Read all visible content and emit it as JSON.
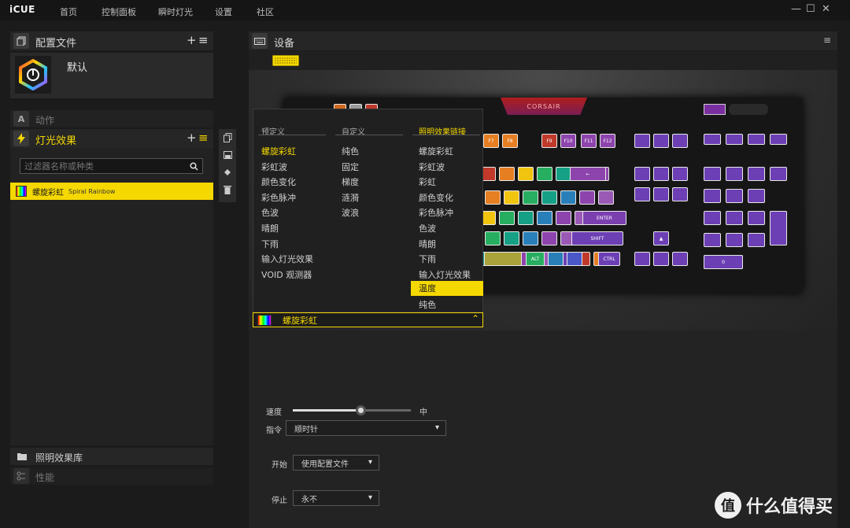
{
  "app": {
    "title": "iCUE"
  },
  "nav": [
    {
      "label": "首页"
    },
    {
      "label": "控制面板"
    },
    {
      "label": "瞬时灯光"
    },
    {
      "label": "设置"
    },
    {
      "label": "社区"
    }
  ],
  "window_controls": {
    "minimize": "—",
    "maximize": "☐",
    "close": "✕"
  },
  "profiles": {
    "title": "配置文件",
    "add": "+",
    "menu": "≡",
    "items": [
      {
        "label": "默认"
      }
    ]
  },
  "actions": {
    "title": "动作",
    "icon_letter": "A"
  },
  "lighting": {
    "title": "灯光效果",
    "add": "+",
    "menu": "≡",
    "filter_placeholder": "过滤器名称或种类",
    "effects": [
      {
        "name_cn": "螺旋彩虹",
        "name_en": "Spiral Rainbow"
      }
    ]
  },
  "library": {
    "title": "照明效果库"
  },
  "performance": {
    "title": "性能"
  },
  "device": {
    "title": "设备",
    "menu_icon": "≡"
  },
  "brand": {
    "logo_text": "CORSAIR",
    "accent": "#f5d800"
  },
  "dropdown": {
    "columns": [
      {
        "head": "预定义",
        "options": [
          "螺旋彩虹",
          "彩虹波",
          "颜色变化",
          "彩色脉冲",
          "色波",
          "晴朗",
          "下雨",
          "输入灯光效果",
          "VOID 观测器"
        ]
      },
      {
        "head": "自定义",
        "options": [
          "纯色",
          "固定",
          "梯度",
          "涟漪",
          "波浪"
        ]
      },
      {
        "head": "照明效果链接",
        "options": [
          "螺旋彩虹",
          "彩虹波",
          "彩虹",
          "颜色变化",
          "彩色脉冲",
          "色波",
          "晴朗",
          "下雨",
          "输入灯光效果"
        ],
        "highlight": "温度",
        "after": "纯色"
      }
    ],
    "current": "螺旋彩虹"
  },
  "settings": {
    "speed": {
      "label": "速度",
      "value": "中",
      "level": 0.57
    },
    "direction": {
      "label": "指令",
      "value": "顺时针"
    },
    "start": {
      "label": "开始",
      "value": "使用配置文件"
    },
    "stop": {
      "label": "停止",
      "value": "永不"
    }
  },
  "watermark": {
    "text": "什么值得买",
    "icon_text": "值"
  },
  "keyboard": {
    "fkeys": [
      "F7",
      "F8",
      "F9",
      "F10",
      "F11",
      "F12"
    ],
    "keys_text": [
      "ENTER",
      "SHIFT",
      "ALT",
      "CTRL",
      "0"
    ]
  }
}
